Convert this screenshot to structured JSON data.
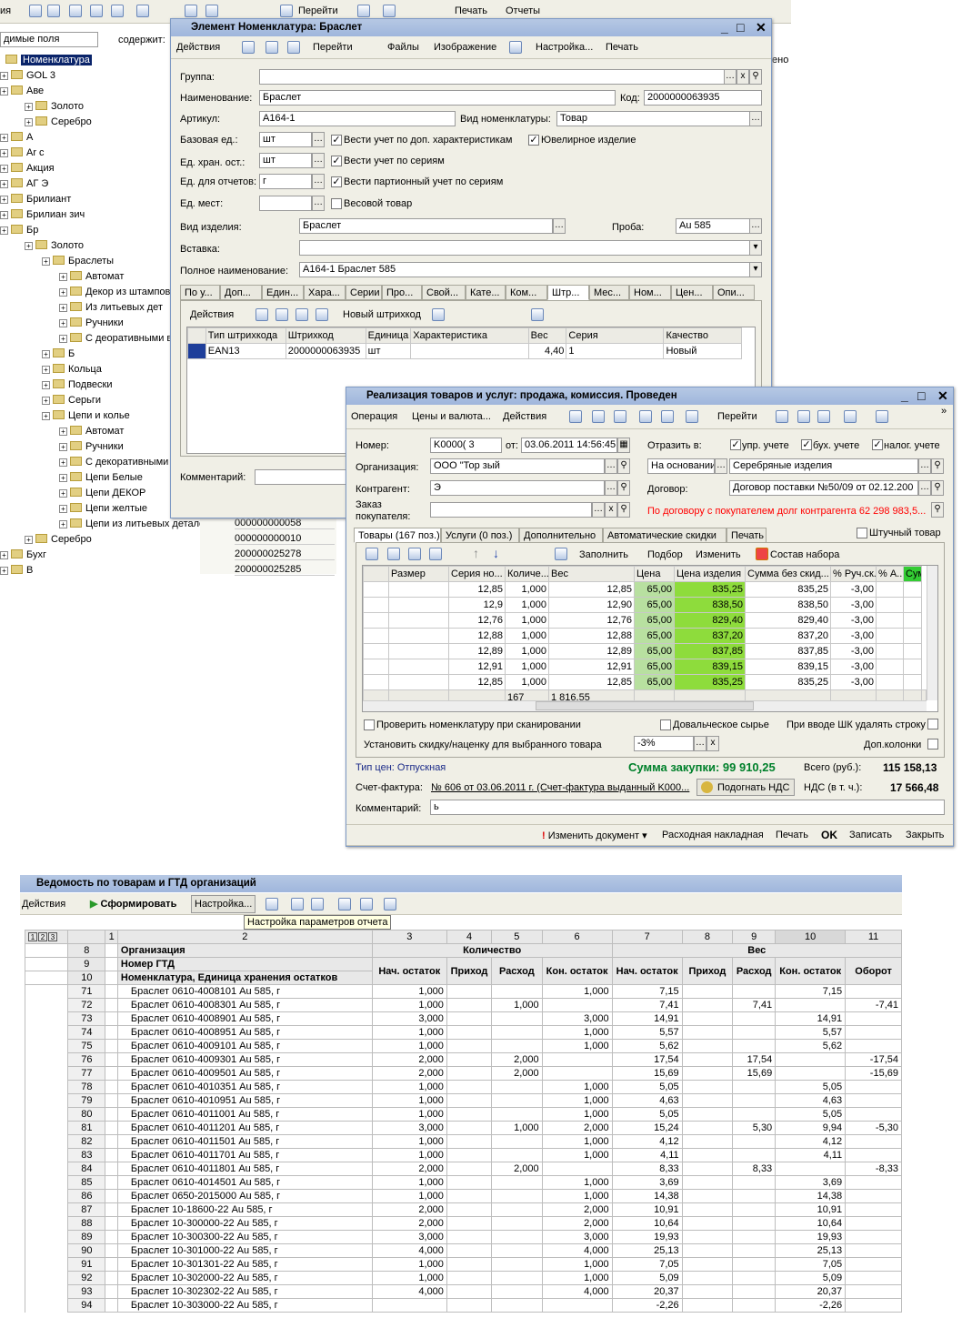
{
  "main_toolbar": {
    "cut_left": "ия",
    "goto": "Перейти",
    "print": "Печать",
    "reports": "Отчеты"
  },
  "left_panel": {
    "field_select": "димые поля",
    "contains_label": "содержит:",
    "tree": [
      "Номенклатура",
      "GOL          3",
      "Аве",
      "Золото",
      "Серебро",
      "А",
      "Ar       c",
      "Акция",
      "АГ           Э",
      "Брилиант",
      "Брилиан                   зич",
      "Бр",
      "Золото",
      "Браслеты",
      "Автомат",
      "Декор из штамповки",
      "Из литьевых дет",
      "Ручники",
      "С деоративными вс",
      "Б",
      "Кольца",
      "Подвески",
      "Серьги",
      "Цепи и колье",
      "Автомат",
      "Ручники",
      "С декоративными в",
      "Цепи Белые",
      "Цепи ДЕКОР",
      "Цепи желтые",
      "Цепи из литьевых деталей",
      "Серебро",
      "Бухг",
      "В"
    ],
    "behind_label": "ено",
    "behind_codes": [
      "000000000058",
      "000000000010",
      "200000025278",
      "200000025285"
    ]
  },
  "element_window": {
    "title": "Элемент Номенклатура: Браслет",
    "toolbar": {
      "actions": "Действия",
      "goto": "Перейти",
      "files": "Файлы",
      "image": "Изображение",
      "settings": "Настройка...",
      "print": "Печать"
    },
    "labels": {
      "group": "Группа:",
      "name": "Наименование:",
      "code": "Код:",
      "article": "Артикул:",
      "kind": "Вид номенклатуры:",
      "base_unit": "Базовая ед.:",
      "storage_unit": "Ед. хран. ост.:",
      "report_unit": "Ед. для отчетов:",
      "place_unit": "Ед. мест:",
      "item_kind": "Вид изделия:",
      "assay": "Проба:",
      "insert": "Вставка:",
      "full_name": "Полное наименование:",
      "comment": "Комментарий:"
    },
    "values": {
      "group": "",
      "name": "Браслет",
      "code": "2000000063935",
      "article": "A164-1",
      "kind": "Товар",
      "base_unit": "шт",
      "storage_unit": "шт",
      "report_unit": "г",
      "place_unit": "",
      "item_kind": "Браслет",
      "assay": "Au 585",
      "insert": "",
      "full_name": "A164-1     Браслет 585",
      "comment": ""
    },
    "checks": [
      {
        "label": "Вести учет по доп. характеристикам",
        "checked": true
      },
      {
        "label": "Ювелирное изделие",
        "checked": true
      },
      {
        "label": "Вести учет по сериям",
        "checked": true
      },
      {
        "label": "Вести партионный учет по сериям",
        "checked": true
      },
      {
        "label": "Весовой товар",
        "checked": false
      }
    ],
    "tabs": [
      "По у...",
      "Доп...",
      "Един...",
      "Хара...",
      "Серии",
      "Про...",
      "Свой...",
      "Кате...",
      "Ком...",
      "Штр...",
      "Мес...",
      "Ном...",
      "Цен...",
      "Опи..."
    ],
    "active_tab": "Штр...",
    "barcode_toolbar": {
      "actions": "Действия",
      "new_barcode": "Новый штрихкод"
    },
    "barcode_columns": [
      "Тип штрихкода",
      "Штрихкод",
      "Единица",
      "Характеристика",
      "Вес",
      "Серия",
      "Качество"
    ],
    "barcode_rows": [
      [
        "EAN13",
        "2000000063935",
        "шт",
        "",
        "4,40",
        "1",
        "Новый"
      ]
    ]
  },
  "sales_window": {
    "title": "Реализация товаров и услуг: продажа, комиссия. Проведен",
    "toolbar": {
      "operation": "Операция",
      "prices": "Цены и валюта...",
      "actions": "Действия",
      "goto": "Перейти"
    },
    "labels": {
      "number": "Номер:",
      "from": "от:",
      "reflect": "Отразить в:",
      "org": "Организация:",
      "counterparty": "Контрагент:",
      "contract": "Договор:",
      "order": "Заказ покупателя:"
    },
    "values": {
      "number": "K0000(         3",
      "date": "03.06.2011 14:56:45",
      "org": "ООО \"Тор     зый",
      "basis": "На основании",
      "basis_value": "Серебряные изделия",
      "counterparty": "Э",
      "contract": "Договор поставки №50/09 от 02.12.200",
      "order": ""
    },
    "reflect_checks": [
      {
        "label": "упр. учете",
        "checked": true
      },
      {
        "label": "бух. учете",
        "checked": true
      },
      {
        "label": "налог. учете",
        "checked": true
      }
    ],
    "debt_warning": "По договору с покупателем долг контрагента 62 298 983,5...",
    "tabs": [
      "Товары (167 поз.)",
      "Услуги (0 поз.)",
      "Дополнительно",
      "Автоматические скидки",
      "Печать"
    ],
    "piece_goods": "Штучный товар",
    "goods_toolbar": {
      "fill": "Заполнить",
      "select": "Подбор",
      "change": "Изменить",
      "set_content": "Состав набора"
    },
    "columns": [
      "Размер",
      "Серия но...",
      "Количе...",
      "Вес",
      "Цена",
      "Цена изделия",
      "Сумма без скид...",
      "% Руч.ск.",
      "% А...",
      "Сум"
    ],
    "rows": [
      [
        "",
        "12,85",
        "1,000",
        "12,85",
        "65,00",
        "835,25",
        "835,25",
        "-3,00"
      ],
      [
        "",
        "12,9",
        "1,000",
        "12,90",
        "65,00",
        "838,50",
        "838,50",
        "-3,00"
      ],
      [
        "",
        "12,76",
        "1,000",
        "12,76",
        "65,00",
        "829,40",
        "829,40",
        "-3,00"
      ],
      [
        "",
        "12,88",
        "1,000",
        "12,88",
        "65,00",
        "837,20",
        "837,20",
        "-3,00"
      ],
      [
        "",
        "12,89",
        "1,000",
        "12,89",
        "65,00",
        "837,85",
        "837,85",
        "-3,00"
      ],
      [
        "",
        "12,91",
        "1,000",
        "12,91",
        "65,00",
        "839,15",
        "839,15",
        "-3,00"
      ],
      [
        "",
        "12,85",
        "1,000",
        "12,85",
        "65,00",
        "835,25",
        "835,25",
        "-3,00"
      ]
    ],
    "totals": {
      "qty": "167",
      "weight": "1 816,55"
    },
    "check_scan": "Проверить номенклатуру при сканировании",
    "tolling": "Довальческое сырье",
    "delete_row": "При вводе ШК удалять строку",
    "discount_label": "Установить скидку/наценку для выбранного товара",
    "discount_value": "-3%",
    "extra_cols": "Доп.колонки",
    "price_type": "Тип цен: Отпускная",
    "purchase_sum": "Сумма закупки: 99 910,25",
    "total_label": "Всего (руб.):",
    "total": "115 158,13",
    "invoice_label": "Счет-фактура:",
    "invoice": "№ 606 от 03.06.2011 г. (Счет-фактура выданный K000...",
    "fit_vat": "Подогнать НДС",
    "vat_label": "НДС (в т. ч.):",
    "vat": "17 566,48",
    "comment_label": "Комментарий:",
    "comment": "                                  ь",
    "bottom": {
      "change_doc": "Изменить документ",
      "waybill": "Расходная накладная",
      "print": "Печать",
      "ok": "OK",
      "save": "Записать",
      "close": "Закрыть"
    },
    "colors": {
      "price_cell": "#b8e0a0",
      "product_price_cell": "#8edc3c",
      "sum_header": "#33cc33",
      "warning": "#ff0000",
      "purchase": "#00802b"
    }
  },
  "report": {
    "title": "Ведомость по товарам и ГТД организаций",
    "toolbar": {
      "actions": "Действия",
      "generate": "Сформировать",
      "settings": "Настройка..."
    },
    "tooltip": "Настройка параметров отчета",
    "levels": [
      "1",
      "2",
      "3"
    ],
    "col_numbers": [
      "1",
      "2",
      "3",
      "4",
      "5",
      "6",
      "7",
      "8",
      "9",
      "10",
      "11"
    ],
    "header_rows": [
      "8",
      "9",
      "10"
    ],
    "header_labels": [
      "Организация",
      "Номер ГТД",
      "Номенклатура, Единица хранения остатков"
    ],
    "group_qty": "Количество",
    "group_weight": "Вес",
    "sub_cols": [
      "Нач. остаток",
      "Приход",
      "Расход",
      "Кон. остаток",
      "Нач. остаток",
      "Приход",
      "Расход",
      "Кон. остаток",
      "Оборот"
    ],
    "rows": [
      [
        "71",
        "Браслет 0610-4008101 Au 585, г",
        "1,000",
        "",
        "",
        "1,000",
        "7,15",
        "",
        "",
        "7,15",
        ""
      ],
      [
        "72",
        "Браслет 0610-4008301 Au 585, г",
        "1,000",
        "",
        "1,000",
        "",
        "7,41",
        "",
        "7,41",
        "",
        "-7,41"
      ],
      [
        "73",
        "Браслет 0610-4008901 Au 585, г",
        "3,000",
        "",
        "",
        "3,000",
        "14,91",
        "",
        "",
        "14,91",
        ""
      ],
      [
        "74",
        "Браслет 0610-4008951 Au 585, г",
        "1,000",
        "",
        "",
        "1,000",
        "5,57",
        "",
        "",
        "5,57",
        ""
      ],
      [
        "75",
        "Браслет 0610-4009101 Au 585, г",
        "1,000",
        "",
        "",
        "1,000",
        "5,62",
        "",
        "",
        "5,62",
        ""
      ],
      [
        "76",
        "Браслет 0610-4009301 Au 585, г",
        "2,000",
        "",
        "2,000",
        "",
        "17,54",
        "",
        "17,54",
        "",
        "-17,54"
      ],
      [
        "77",
        "Браслет 0610-4009501 Au 585, г",
        "2,000",
        "",
        "2,000",
        "",
        "15,69",
        "",
        "15,69",
        "",
        "-15,69"
      ],
      [
        "78",
        "Браслет 0610-4010351 Au 585, г",
        "1,000",
        "",
        "",
        "1,000",
        "5,05",
        "",
        "",
        "5,05",
        ""
      ],
      [
        "79",
        "Браслет 0610-4010951 Au 585, г",
        "1,000",
        "",
        "",
        "1,000",
        "4,63",
        "",
        "",
        "4,63",
        ""
      ],
      [
        "80",
        "Браслет 0610-4011001 Au 585, г",
        "1,000",
        "",
        "",
        "1,000",
        "5,05",
        "",
        "",
        "5,05",
        ""
      ],
      [
        "81",
        "Браслет 0610-4011201 Au 585, г",
        "3,000",
        "",
        "1,000",
        "2,000",
        "15,24",
        "",
        "5,30",
        "9,94",
        "-5,30"
      ],
      [
        "82",
        "Браслет 0610-4011501 Au 585, г",
        "1,000",
        "",
        "",
        "1,000",
        "4,12",
        "",
        "",
        "4,12",
        ""
      ],
      [
        "83",
        "Браслет 0610-4011701 Au 585, г",
        "1,000",
        "",
        "",
        "1,000",
        "4,11",
        "",
        "",
        "4,11",
        ""
      ],
      [
        "84",
        "Браслет 0610-4011801 Au 585, г",
        "2,000",
        "",
        "2,000",
        "",
        "8,33",
        "",
        "8,33",
        "",
        "-8,33"
      ],
      [
        "85",
        "Браслет 0610-4014501 Au 585, г",
        "1,000",
        "",
        "",
        "1,000",
        "3,69",
        "",
        "",
        "3,69",
        ""
      ],
      [
        "86",
        "Браслет 0650-2015000 Au 585, г",
        "1,000",
        "",
        "",
        "1,000",
        "14,38",
        "",
        "",
        "14,38",
        ""
      ],
      [
        "87",
        "Браслет 10-18600-22 Au 585, г",
        "2,000",
        "",
        "",
        "2,000",
        "10,91",
        "",
        "",
        "10,91",
        ""
      ],
      [
        "88",
        "Браслет 10-300000-22 Au 585, г",
        "2,000",
        "",
        "",
        "2,000",
        "10,64",
        "",
        "",
        "10,64",
        ""
      ],
      [
        "89",
        "Браслет 10-300300-22 Au 585, г",
        "3,000",
        "",
        "",
        "3,000",
        "19,93",
        "",
        "",
        "19,93",
        ""
      ],
      [
        "90",
        "Браслет 10-301000-22 Au 585, г",
        "4,000",
        "",
        "",
        "4,000",
        "25,13",
        "",
        "",
        "25,13",
        ""
      ],
      [
        "91",
        "Браслет 10-301301-22 Au 585, г",
        "1,000",
        "",
        "",
        "1,000",
        "7,05",
        "",
        "",
        "7,05",
        ""
      ],
      [
        "92",
        "Браслет 10-302000-22 Au 585, г",
        "1,000",
        "",
        "",
        "1,000",
        "5,09",
        "",
        "",
        "5,09",
        ""
      ],
      [
        "93",
        "Браслет 10-302302-22 Au 585, г",
        "4,000",
        "",
        "",
        "4,000",
        "20,37",
        "",
        "",
        "20,37",
        ""
      ],
      [
        "94",
        "Браслет 10-303000-22 Au 585, г",
        "",
        "",
        "",
        "",
        "-2,26",
        "",
        "",
        "-2,26",
        ""
      ]
    ]
  }
}
